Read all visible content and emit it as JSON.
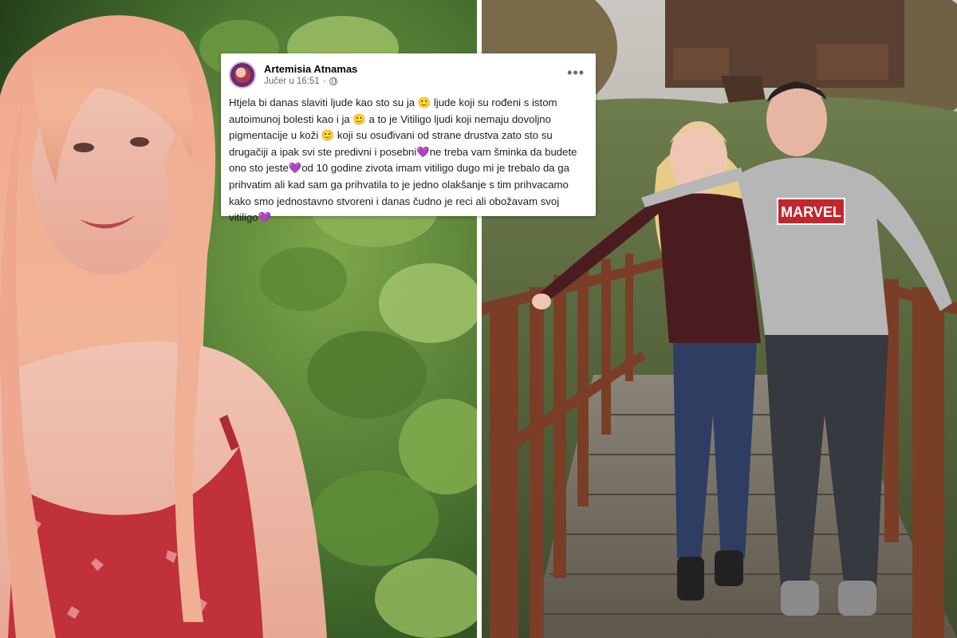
{
  "post": {
    "author": "Artemisia Atnamas",
    "time": "Jučer u 16:51",
    "privacy_icon": "globe-icon",
    "more_label": "•••",
    "text": "Htjela bi danas slaviti ljude kao sto su ja 🙂 ljude koji su rođeni s istom autoimunoj bolesti kao i ja 🙂 a to je Vitiligo ljudi koji nemaju dovoljno pigmentacije u koži 🙂 koji su osuđivani od strane drustva zato sto su drugačiji a ipak svi ste predivni i posebni💜ne treba vam šminka da budete ono sto jeste💜od 10 godine zivota imam vitiligo dugo mi je trebalo da ga prihvatim ali kad sam ga prihvatila to je jedno olakšanje s tim prihvacamo kako smo jednostavno stvoreni i danas čudno je reci ali obožavam svoj vitiligo💜"
  },
  "shirt_print": "MARVEL"
}
